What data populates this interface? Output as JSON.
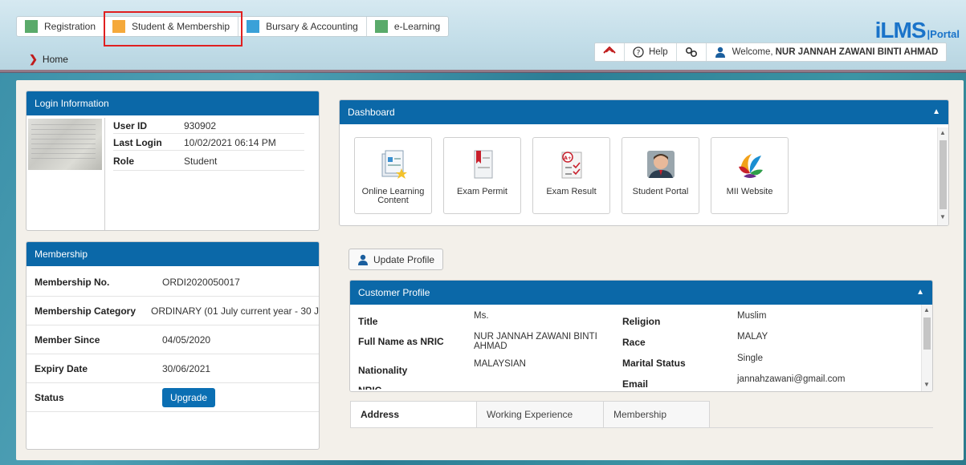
{
  "modules": [
    {
      "label": "Registration",
      "color": "#5aaa6a"
    },
    {
      "label": "Student & Membership",
      "color": "#f5a93b"
    },
    {
      "label": "Bursary & Accounting",
      "color": "#3aa1d8"
    },
    {
      "label": "e-Learning",
      "color": "#5aaa6a"
    }
  ],
  "logo": {
    "main": "iLMS",
    "sub": "|Portal"
  },
  "userbar": {
    "home_icon": "home-icon",
    "help_label": "Help",
    "link_icon": "link-icon",
    "welcome_prefix": "Welcome,",
    "user_name": "NUR JANNAH ZAWANI BINTI AHMAD"
  },
  "breadcrumb": {
    "current": "Home"
  },
  "login_info": {
    "title": "Login Information",
    "rows": [
      {
        "key": "User ID",
        "value": "930902"
      },
      {
        "key": "Last Login",
        "value": "10/02/2021 06:14 PM"
      },
      {
        "key": "Role",
        "value": "Student"
      }
    ]
  },
  "membership": {
    "title": "Membership",
    "rows": [
      {
        "key": "Membership No.",
        "value": "ORDI2020050017"
      },
      {
        "key": "Membership Category",
        "value": "ORDINARY (01 July current year - 30 J"
      },
      {
        "key": "Member Since",
        "value": "04/05/2020"
      },
      {
        "key": "Expiry Date",
        "value": "30/06/2021"
      },
      {
        "key": "Status",
        "value": ""
      }
    ],
    "upgrade_label": "Upgrade"
  },
  "dashboard": {
    "title": "Dashboard",
    "tiles": [
      {
        "label": "Online Learning Content",
        "icon": "document-star-icon"
      },
      {
        "label": "Exam Permit",
        "icon": "bookmark-document-icon"
      },
      {
        "label": "Exam Result",
        "icon": "grade-checklist-icon"
      },
      {
        "label": "Student Portal",
        "icon": "student-avatar-icon"
      },
      {
        "label": "MII Website",
        "icon": "mii-logo-icon"
      }
    ]
  },
  "update_profile_label": "Update Profile",
  "customer_profile": {
    "title": "Customer Profile",
    "left": [
      {
        "key": "Title",
        "value": "Ms."
      },
      {
        "key": "Full Name as NRIC",
        "value": "NUR JANNAH ZAWANI BINTI AHMAD"
      },
      {
        "key": "Nationality",
        "value": "MALAYSIAN"
      },
      {
        "key": "NRIC",
        "value": ""
      }
    ],
    "right": [
      {
        "key": "Religion",
        "value": "Muslim"
      },
      {
        "key": "Race",
        "value": "MALAY"
      },
      {
        "key": "Marital Status",
        "value": "Single"
      },
      {
        "key": "Email",
        "value": "jannahzawani@gmail.com"
      }
    ]
  },
  "tabs": [
    "Address",
    "Working Experience",
    "Membership"
  ]
}
